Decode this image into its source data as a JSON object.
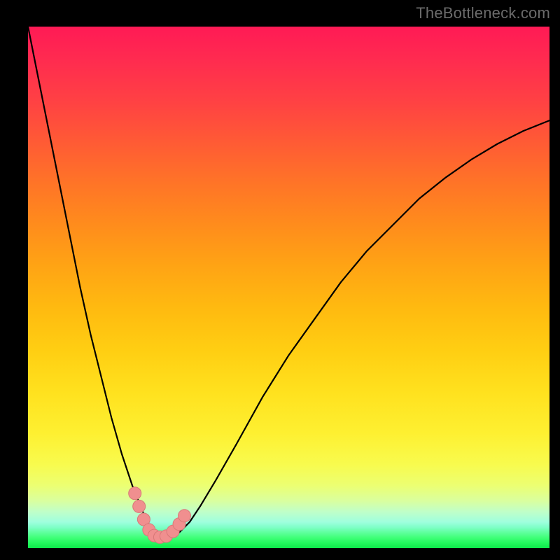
{
  "watermark": "TheBottleneck.com",
  "colors": {
    "frame_bg": "#000000",
    "curve_stroke": "#000000",
    "marker_fill": "#f08f8f",
    "marker_stroke": "#d87878"
  },
  "chart_data": {
    "type": "line",
    "title": "",
    "xlabel": "",
    "ylabel": "",
    "xlim": [
      0,
      100
    ],
    "ylim": [
      0,
      100
    ],
    "grid": false,
    "legend": false,
    "series": [
      {
        "name": "curve-v",
        "x": [
          0,
          2,
          4,
          6,
          8,
          10,
          12,
          14,
          16,
          18,
          20,
          22,
          23.5,
          25,
          27,
          29,
          31,
          33,
          36,
          40,
          45,
          50,
          55,
          60,
          65,
          70,
          75,
          80,
          85,
          90,
          95,
          100
        ],
        "values": [
          100,
          90,
          80,
          70,
          60,
          50,
          41,
          33,
          25,
          18,
          12,
          7,
          3.5,
          2,
          2.2,
          3,
          5,
          8,
          13,
          20,
          29,
          37,
          44,
          51,
          57,
          62,
          67,
          71,
          74.5,
          77.5,
          80,
          82
        ]
      }
    ],
    "optimum_x": 25,
    "markers": [
      {
        "x": 20.5,
        "y": 10.5
      },
      {
        "x": 21.3,
        "y": 8.0
      },
      {
        "x": 22.2,
        "y": 5.5
      },
      {
        "x": 23.2,
        "y": 3.5
      },
      {
        "x": 24.2,
        "y": 2.4
      },
      {
        "x": 25.3,
        "y": 2.1
      },
      {
        "x": 26.5,
        "y": 2.3
      },
      {
        "x": 27.8,
        "y": 3.2
      },
      {
        "x": 29.0,
        "y": 4.6
      },
      {
        "x": 30.0,
        "y": 6.2
      }
    ]
  }
}
